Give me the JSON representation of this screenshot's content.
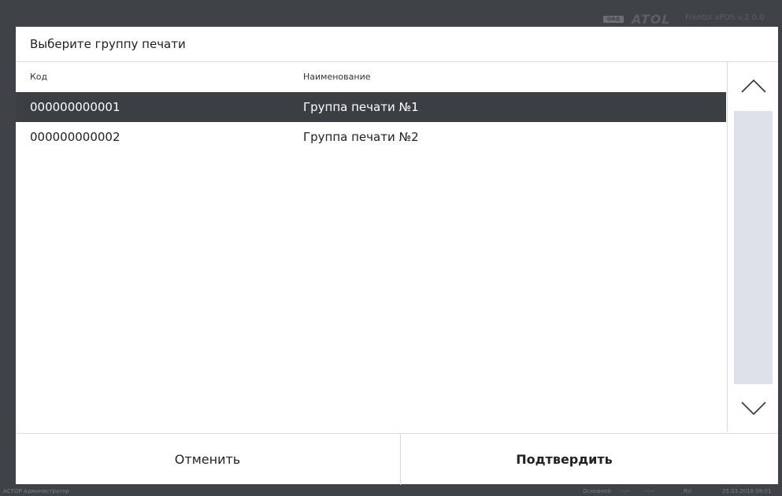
{
  "app": {
    "ofd_badge": "ОФД",
    "brand": "ATOL",
    "version": "Frontol xPOS v.2.0.0"
  },
  "dialog": {
    "title": "Выберите группу печати",
    "columns": {
      "code": "Код",
      "name": "Наименование"
    },
    "rows": [
      {
        "code": "000000000001",
        "name": "Группа печати №1",
        "selected": true
      },
      {
        "code": "000000000002",
        "name": "Группа печати №2",
        "selected": false
      }
    ],
    "cancel_label": "Отменить",
    "confirm_label": "Подтвердить"
  },
  "status_bar": {
    "user": "АСТОР  Администратор",
    "mode": "Основной",
    "time1": "--:--",
    "time2": "--:--",
    "lang": "RU",
    "datetime": "25.03.2018 09:01"
  },
  "colors": {
    "background": "#3f4246",
    "selected_row": "#3b3f43",
    "scroll_track": "#dde2ea"
  },
  "icons": {
    "scroll_up": "chevron-up-icon",
    "scroll_down": "chevron-down-icon"
  }
}
